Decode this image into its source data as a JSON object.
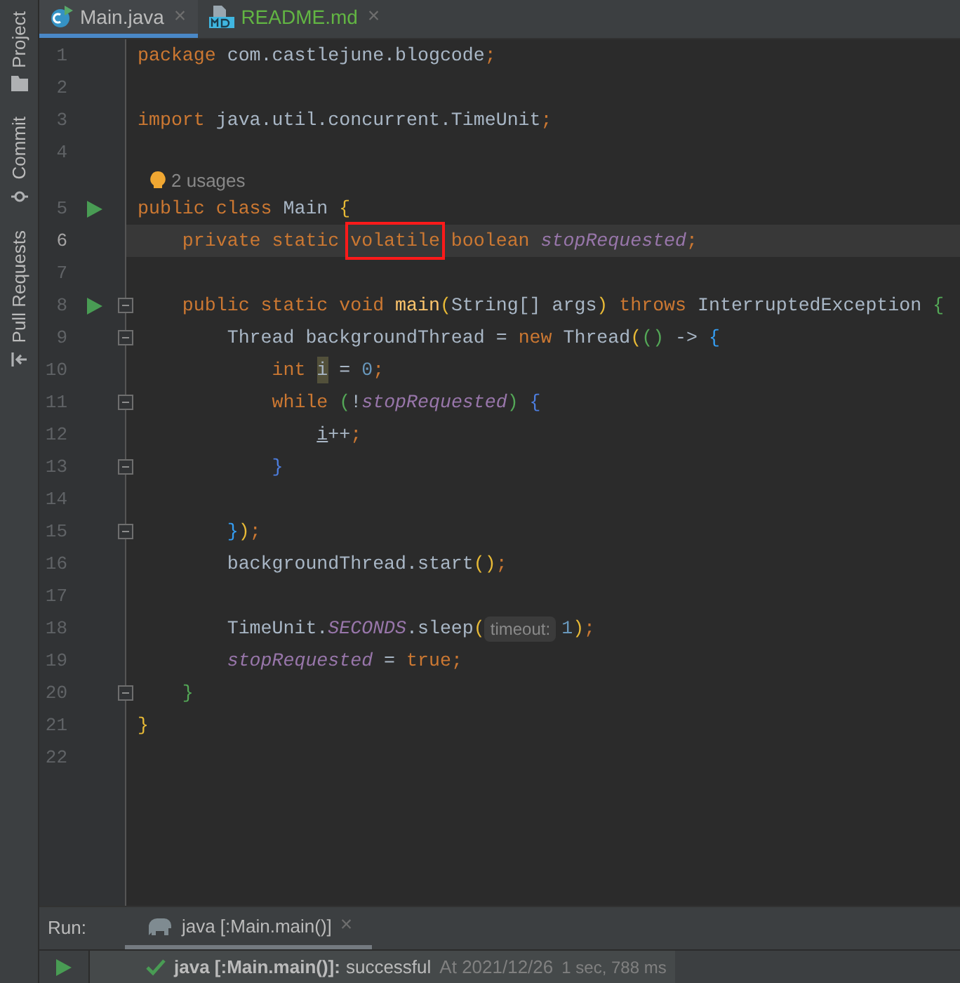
{
  "tool_strip": [
    {
      "label": "Project"
    },
    {
      "label": "Commit"
    },
    {
      "label": "Pull Requests"
    }
  ],
  "tabs": [
    {
      "label": "Main.java",
      "color": "#bbbbbb",
      "selected": true,
      "close": "×"
    },
    {
      "label": "README.md",
      "color": "#62b543",
      "selected": false,
      "close": "×"
    }
  ],
  "editor": {
    "lines": [
      {
        "number": "1",
        "current": false,
        "run": false,
        "fold": false,
        "tokens": [
          {
            "kind": "kw",
            "text": "package "
          },
          {
            "kind": "plain",
            "text": "com.castlejune.blogcode"
          },
          {
            "kind": "kw",
            "text": ";"
          }
        ]
      },
      {
        "number": "2",
        "current": false,
        "run": false,
        "fold": false
      },
      {
        "number": "3",
        "current": false,
        "run": false,
        "fold": false,
        "tokens": [
          {
            "kind": "kw",
            "text": "import "
          },
          {
            "kind": "plain",
            "text": "java.util.concurrent.TimeUnit"
          },
          {
            "kind": "kw",
            "text": ";"
          }
        ]
      },
      {
        "number": "4",
        "current": false,
        "run": false,
        "fold": false
      },
      {
        "number": "5",
        "current": false,
        "run": true,
        "fold": false,
        "tokens": [
          {
            "kind": "kw",
            "text": "public class "
          },
          {
            "kind": "plain",
            "text": "Main "
          },
          {
            "kind": "paren1",
            "text": "{"
          }
        ],
        "inlay": "2 usages"
      },
      {
        "number": "6",
        "current": true,
        "run": false,
        "fold": false,
        "tokens": [
          {
            "kind": "kw",
            "text": "    private static "
          },
          {
            "kind": "boxed",
            "text": "volatile"
          },
          {
            "kind": "kw",
            "text": " boolean "
          },
          {
            "kind": "field",
            "text": "stopRequested"
          },
          {
            "kind": "kw",
            "text": ";"
          }
        ]
      },
      {
        "number": "7",
        "current": false,
        "run": false,
        "fold": false
      },
      {
        "number": "8",
        "current": false,
        "run": true,
        "fold": true,
        "tokens": [
          {
            "kind": "kw",
            "text": "    public static void "
          },
          {
            "kind": "fn",
            "text": "main"
          },
          {
            "kind": "paren1",
            "text": "("
          },
          {
            "kind": "plain",
            "text": "String[] args"
          },
          {
            "kind": "paren1",
            "text": ")"
          },
          {
            "kind": "kw",
            "text": " throws "
          },
          {
            "kind": "plain",
            "text": "InterruptedException "
          },
          {
            "kind": "paren2",
            "text": "{"
          }
        ]
      },
      {
        "number": "9",
        "current": false,
        "run": false,
        "fold": true,
        "tokens": [
          {
            "kind": "plain",
            "text": "        Thread backgroundThread = "
          },
          {
            "kind": "kw",
            "text": "new "
          },
          {
            "kind": "plain",
            "text": "Thread"
          },
          {
            "kind": "paren1",
            "text": "("
          },
          {
            "kind": "paren2",
            "text": "()"
          },
          {
            "kind": "plain",
            "text": " -> "
          },
          {
            "kind": "paren3",
            "text": "{"
          }
        ]
      },
      {
        "number": "10",
        "current": false,
        "run": false,
        "fold": false,
        "tokens": [
          {
            "kind": "kw",
            "text": "            int "
          },
          {
            "kind": "var_hl",
            "text": "i"
          },
          {
            "kind": "plain",
            "text": " = "
          },
          {
            "kind": "num",
            "text": "0"
          },
          {
            "kind": "kw",
            "text": ";"
          }
        ]
      },
      {
        "number": "11",
        "current": false,
        "run": false,
        "fold": true,
        "tokens": [
          {
            "kind": "kw",
            "text": "            while "
          },
          {
            "kind": "paren2",
            "text": "("
          },
          {
            "kind": "plain",
            "text": "!"
          },
          {
            "kind": "field",
            "text": "stopRequested"
          },
          {
            "kind": "paren2",
            "text": ")"
          },
          {
            "kind": "paren4",
            "text": " {"
          }
        ]
      },
      {
        "number": "12",
        "current": false,
        "run": false,
        "fold": false,
        "tokens": [
          {
            "kind": "var_mut",
            "text": "                i"
          },
          {
            "kind": "plain",
            "text": "++"
          },
          {
            "kind": "kw",
            "text": ";"
          }
        ]
      },
      {
        "number": "13",
        "current": false,
        "run": false,
        "fold": true,
        "tokens": [
          {
            "kind": "paren4",
            "text": "            }"
          }
        ]
      },
      {
        "number": "14",
        "current": false,
        "run": false,
        "fold": false
      },
      {
        "number": "15",
        "current": false,
        "run": false,
        "fold": true,
        "tokens": [
          {
            "kind": "paren3",
            "text": "        }"
          },
          {
            "kind": "paren1",
            "text": ")"
          },
          {
            "kind": "kw",
            "text": ";"
          }
        ]
      },
      {
        "number": "16",
        "current": false,
        "run": false,
        "fold": false,
        "tokens": [
          {
            "kind": "plain",
            "text": "        backgroundThread.start"
          },
          {
            "kind": "paren1",
            "text": "()"
          },
          {
            "kind": "kw",
            "text": ";"
          }
        ]
      },
      {
        "number": "17",
        "current": false,
        "run": false,
        "fold": false
      },
      {
        "number": "18",
        "current": false,
        "run": false,
        "fold": false,
        "tokens": [
          {
            "kind": "plain",
            "text": "        TimeUnit."
          },
          {
            "kind": "field",
            "text": "SECONDS"
          },
          {
            "kind": "plain",
            "text": ".sleep"
          },
          {
            "kind": "paren1",
            "text": "("
          },
          {
            "kind": "hint",
            "text": "timeout:"
          },
          {
            "kind": "num",
            "text": "1"
          },
          {
            "kind": "paren1",
            "text": ")"
          },
          {
            "kind": "kw",
            "text": ";"
          }
        ]
      },
      {
        "number": "19",
        "current": false,
        "run": false,
        "fold": false,
        "tokens": [
          {
            "kind": "field",
            "text": "        stopRequested"
          },
          {
            "kind": "plain",
            "text": " = "
          },
          {
            "kind": "kw",
            "text": "true;"
          }
        ]
      },
      {
        "number": "20",
        "current": false,
        "run": false,
        "fold": true,
        "tokens": [
          {
            "kind": "paren2",
            "text": "    }"
          }
        ]
      },
      {
        "number": "21",
        "current": false,
        "run": false,
        "fold": false,
        "tokens": [
          {
            "kind": "paren1",
            "text": "}"
          }
        ]
      },
      {
        "number": "22",
        "current": false,
        "run": false,
        "fold": false
      }
    ]
  },
  "run_panel": {
    "label": "Run:",
    "tabs": [
      {
        "label": "java [:Main.main()]",
        "close": "×",
        "selected": true
      }
    ],
    "result": {
      "task": "java [:Main.main()]:",
      "status": "successful",
      "time": "At 2021/12/26",
      "duration": "1 sec, 788 ms"
    }
  }
}
